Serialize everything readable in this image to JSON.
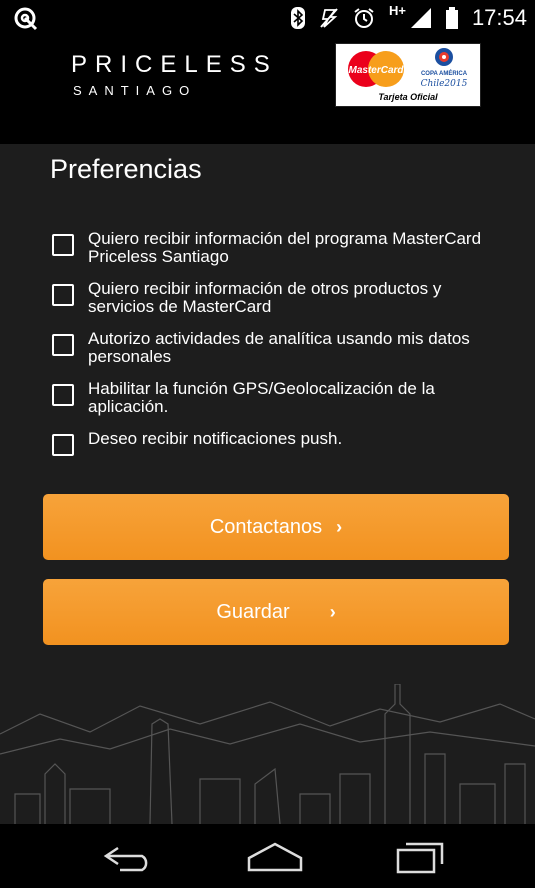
{
  "status_bar": {
    "time": "17:54",
    "network": "H+",
    "icons": [
      "app-icon",
      "bluetooth-icon",
      "mute-icon",
      "alarm-icon",
      "signal-icon",
      "battery-icon"
    ]
  },
  "header": {
    "brand_title": "PRICELESS",
    "brand_subtitle": "SANTIAGO",
    "sponsor": {
      "card_brand": "MasterCard",
      "event_name": "COPA AMÉRICA",
      "event_sub": "Chile2015",
      "tag": "Tarjeta Oficial"
    }
  },
  "page": {
    "title": "Preferencias"
  },
  "preferences": [
    {
      "label": "Quiero recibir información del programa MasterCard Priceless Santiago",
      "checked": false
    },
    {
      "label": "Quiero recibir información de otros productos y servicios de MasterCard",
      "checked": false
    },
    {
      "label": "Autorizo actividades de analítica usando mis datos personales",
      "checked": false
    },
    {
      "label": "Habilitar la función GPS/Geolocalización de la aplicación.",
      "checked": false
    },
    {
      "label": "Deseo recibir notificaciones push.",
      "checked": false
    }
  ],
  "buttons": {
    "contact_label": "Contactanos",
    "save_label": "Guardar",
    "chevron": "›"
  },
  "colors": {
    "accent": "#f39a2b",
    "background": "#1d1d1d",
    "mastercard_red": "#eb001b",
    "mastercard_orange": "#f79e1b"
  }
}
